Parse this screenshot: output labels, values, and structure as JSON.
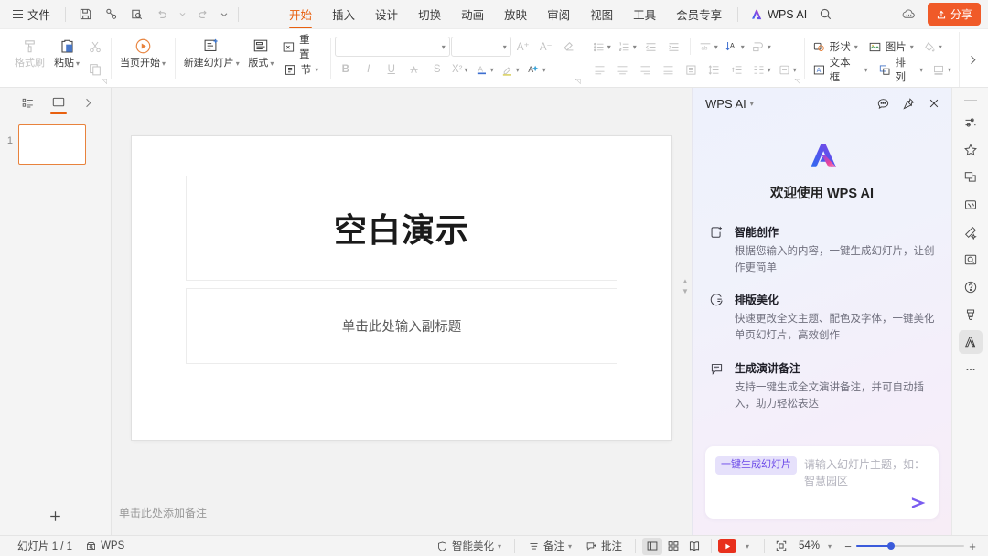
{
  "titlebar": {
    "file_label": "文件",
    "quick_icons": [
      {
        "name": "save-icon",
        "title": "保存"
      },
      {
        "name": "output-pdf-icon",
        "title": "输出为PDF"
      },
      {
        "name": "print-preview-icon",
        "title": "打印预览"
      },
      {
        "name": "undo-icon",
        "title": "撤销"
      },
      {
        "name": "redo-icon",
        "title": "恢复"
      },
      {
        "name": "customize-quick-access-icon",
        "title": "自定义快速访问工具栏"
      }
    ],
    "tabs": [
      {
        "label": "开始",
        "active": true
      },
      {
        "label": "插入",
        "active": false
      },
      {
        "label": "设计",
        "active": false
      },
      {
        "label": "切换",
        "active": false
      },
      {
        "label": "动画",
        "active": false
      },
      {
        "label": "放映",
        "active": false
      },
      {
        "label": "审阅",
        "active": false
      },
      {
        "label": "视图",
        "active": false
      },
      {
        "label": "工具",
        "active": false
      },
      {
        "label": "会员专享",
        "active": false
      }
    ],
    "wps_ai_label": "WPS AI",
    "search_title": "搜索",
    "cloud_title": "云服务",
    "share_label": "分享",
    "active_tab_color": "#e8600f",
    "share_color": "#f05a28"
  },
  "ribbon": {
    "clipboard": {
      "format_painter": "格式刷",
      "paste": "粘贴",
      "cut_title": "剪切",
      "copy_title": "复制"
    },
    "present": {
      "from_current": "当页开始"
    },
    "slides": {
      "new_slide": "新建幻灯片",
      "layout": "版式",
      "reset": "重置",
      "section": "节"
    },
    "font": {
      "font_name": "",
      "font_size": "",
      "font_name_placeholder": "",
      "font_size_placeholder": "",
      "grow_font": "A⁺",
      "shrink_font": "A⁻",
      "clear_format_title": "清除格式",
      "bold": "B",
      "italic": "I",
      "underline": "U",
      "strike_through_title": "删除线",
      "shadow": "S",
      "superscript": "X²",
      "font_color_title": "字体颜色",
      "highlight_title": "突出显示",
      "text_effect_title": "文本效果"
    },
    "paragraph": {
      "bullets_title": "项目符号",
      "numbering_title": "编号",
      "decrease_indent_title": "减少缩进量",
      "increase_indent_title": "增加缩进量",
      "text_direction_title": "文字方向",
      "align_text_title": "对齐文本",
      "convert_smartart_title": "转换为智能图形",
      "align_left_title": "左对齐",
      "align_center_title": "居中对齐",
      "align_right_title": "右对齐",
      "justify_title": "两端对齐",
      "distribute_title": "分散对齐",
      "line_spacing_title": "行距",
      "paragraph_spacing_title": "段落间距",
      "columns_title": "分栏",
      "align_vertical_title": "垂直对齐"
    },
    "drawing": {
      "shape": "形状",
      "textbox": "文本框",
      "picture": "图片",
      "arrange": "排列",
      "fill_title": "填充",
      "outline_title": "轮廓"
    },
    "expand_title": "展开",
    "more_title": "更多"
  },
  "slide_panel": {
    "outline_tab_title": "大纲",
    "slide_tab_title": "幻灯片",
    "collapse_title": "收起",
    "slides": [
      {
        "number": "1"
      }
    ],
    "add_slide_title": "新建幻灯片"
  },
  "slide": {
    "title": "空白演示",
    "subtitle": "单击此处输入副标题",
    "notes_placeholder": "单击此处添加备注"
  },
  "ai_panel": {
    "header_title": "WPS AI",
    "chat_history_title": "历史会话",
    "pin_title": "固定",
    "close_title": "关闭",
    "logo_name": "wps-ai-logo",
    "welcome": "欢迎使用 WPS AI",
    "features": [
      {
        "icon": "smart-create-icon",
        "title": "智能创作",
        "desc": "根据您输入的内容，一键生成幻灯片，让创作更简单"
      },
      {
        "icon": "beautify-icon",
        "title": "排版美化",
        "desc": "快速更改全文主题、配色及字体，一键美化单页幻灯片，高效创作"
      },
      {
        "icon": "speaker-notes-icon",
        "title": "生成演讲备注",
        "desc": "支持一键生成全文演讲备注，并可自动插入，助力轻松表达"
      }
    ],
    "input": {
      "chip_label": "一键生成幻灯片",
      "placeholder": "请输入幻灯片主题，如：智慧园区",
      "value": "",
      "send_title": "发送"
    },
    "accent_color": "#7a5cf0",
    "chip_bg": "#e6e1fb"
  },
  "right_rail": {
    "icons": [
      {
        "name": "properties-icon",
        "title": "属性"
      },
      {
        "name": "favorites-icon",
        "title": "收藏"
      },
      {
        "name": "resources-icon",
        "title": "素材库"
      },
      {
        "name": "template-icon",
        "title": "稻壳模板"
      },
      {
        "name": "beautify-tool-icon",
        "title": "一键美化"
      },
      {
        "name": "image-search-icon",
        "title": "图片搜索"
      },
      {
        "name": "help-icon",
        "title": "帮助"
      },
      {
        "name": "skill-icon",
        "title": "技巧"
      },
      {
        "name": "wps-ai-rail-icon",
        "title": "WPS AI",
        "active": true
      },
      {
        "name": "more-icon",
        "title": "更多"
      }
    ]
  },
  "status_bar": {
    "slide_count": "幻灯片 1 / 1",
    "wps_label": "WPS",
    "beautify": "智能美化",
    "notes": "备注",
    "comment": "批注",
    "view_normal_title": "普通视图",
    "view_sorter_title": "幻灯片浏览",
    "view_reading_title": "阅读视图",
    "play_title": "从头开始",
    "fit_title": "适应窗口",
    "zoom": "54%",
    "zoom_out": "−",
    "zoom_in": "+"
  }
}
